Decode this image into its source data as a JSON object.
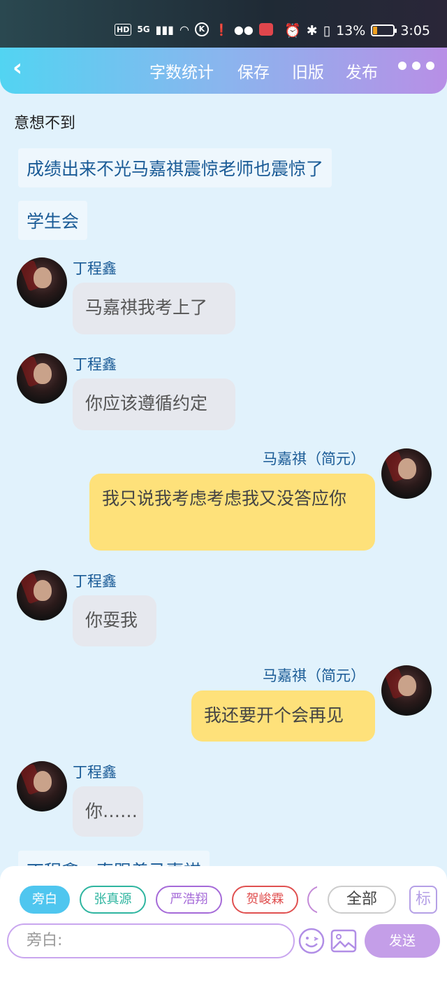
{
  "status_bar": {
    "hd": "HD",
    "network": "5G",
    "k_icon": "K",
    "battery_percent": "13%",
    "time": "3:05"
  },
  "topbar": {
    "word_count": "字数统计",
    "save": "保存",
    "old_version": "旧版",
    "publish": "发布"
  },
  "content": {
    "plain_text": "意想不到",
    "narration_1": "成绩出来不光马嘉祺震惊老师也震惊了",
    "narration_2": "学生会",
    "messages": [
      {
        "name": "丁程鑫",
        "text": "马嘉祺我考上了"
      },
      {
        "name": "丁程鑫",
        "text": "你应该遵循约定"
      },
      {
        "name": "马嘉祺（简元）",
        "text": "我只说我考虑考虑我又没答应你"
      },
      {
        "name": "丁程鑫",
        "text": "你耍我"
      },
      {
        "name": "马嘉祺（简元）",
        "text": "我还要开个会再见"
      },
      {
        "name": "丁程鑫",
        "text": "你……"
      }
    ],
    "partial_narration": "丁程鑫一直跟着马嘉祺"
  },
  "bottom": {
    "chips": [
      "旁白",
      "张真源",
      "严浩翔",
      "贺峻霖"
    ],
    "chip_colors": [
      "#4fc6ef",
      "#2fb5a0",
      "#a56ad8",
      "#e05050",
      "#c48ad8"
    ],
    "all": "全部",
    "mark": "标",
    "input_placeholder": "旁白:",
    "send": "发送"
  }
}
